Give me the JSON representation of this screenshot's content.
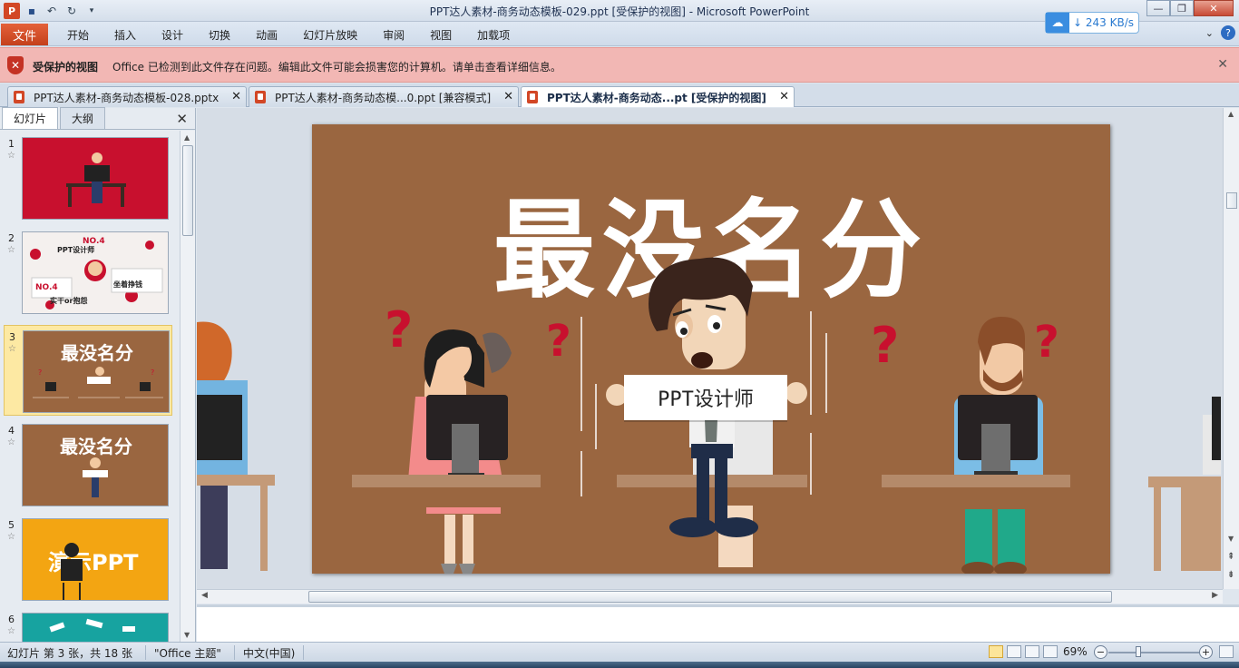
{
  "window": {
    "title": "PPT达人素材-商务动态模板-029.ppt [受保护的视图]  -  Microsoft PowerPoint"
  },
  "speed": {
    "value": "243 KB/s"
  },
  "ribbon": {
    "file": "文件",
    "tabs": [
      "开始",
      "插入",
      "设计",
      "切换",
      "动画",
      "幻灯片放映",
      "审阅",
      "视图",
      "加载项"
    ]
  },
  "protected": {
    "title": "受保护的视图",
    "message": "Office 已检测到此文件存在问题。编辑此文件可能会损害您的计算机。请单击查看详细信息。"
  },
  "doc_tabs": [
    {
      "label": "PPT达人素材-商务动态模板-028.pptx"
    },
    {
      "label": "PPT达人素材-商务动态模...0.ppt [兼容模式]"
    },
    {
      "label": "PPT达人素材-商务动态...pt [受保护的视图]"
    }
  ],
  "left_pane": {
    "tabs": [
      "幻灯片",
      "大纲"
    ],
    "slides": [
      {
        "num": "1",
        "star": "☆"
      },
      {
        "num": "2",
        "star": "☆"
      },
      {
        "num": "3",
        "star": "☆"
      },
      {
        "num": "4",
        "star": "☆"
      },
      {
        "num": "5",
        "star": "☆"
      },
      {
        "num": "6",
        "star": "☆"
      }
    ],
    "thumb2_text": [
      "PPT设计师",
      "NO.4",
      "实干or抱怨",
      "坐着挣钱",
      "NO.4"
    ],
    "thumb3_text": "最没名分",
    "thumb4_text": "最没名分",
    "thumb5_text": "演示PPT"
  },
  "slide": {
    "headline": "最没名分",
    "sign": "PPT设计师",
    "question": "?"
  },
  "status": {
    "slide_info": "幻灯片 第 3 张，共 18 张",
    "theme": "\"Office 主题\"",
    "language": "中文(中国)",
    "zoom": "69%"
  },
  "colors": {
    "slide_bg": "#9a6640",
    "accent_red": "#c8102e",
    "file_tab": "#d4502a"
  }
}
